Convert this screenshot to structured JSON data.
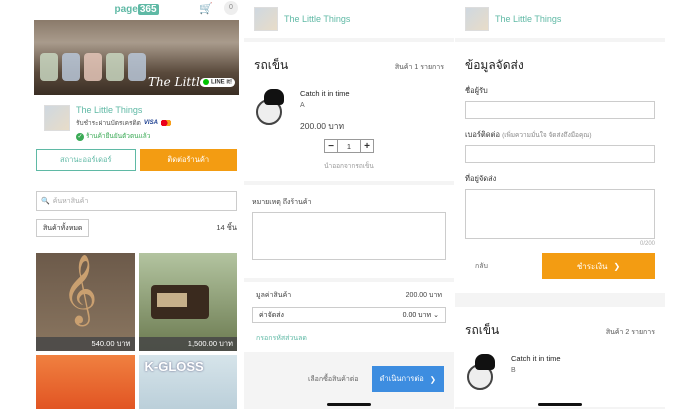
{
  "screen1": {
    "logo_prefix": "page",
    "logo_suffix": "365",
    "cart_count": "0",
    "banner_text": "The Little",
    "line_badge": "LINE it!",
    "shop_name": "The Little Things",
    "payment_text": "รับชำระผ่านบัตรเครดิต",
    "visa": "VISA",
    "verified_text": "ร้านค้ายืนยันตัวตนแล้ว",
    "order_status_button": "สถานะออร์เดอร์",
    "contact_button": "ติดต่อร้านค้า",
    "search_placeholder": "ค้นหาสินค้า",
    "category_select": "สินค้าทั้งหมด",
    "item_count": "14 ชิ้น",
    "products": [
      {
        "price": "540.00 บาท"
      },
      {
        "price": "1,500.00 บาท"
      },
      {
        "price": ""
      },
      {
        "price": ""
      }
    ],
    "kgloss_label": "K-GLOSS"
  },
  "screen2": {
    "shop_name": "The Little Things",
    "cart_title": "รถเข็น",
    "cart_summary": "สินค้า 1 รายการ",
    "item": {
      "name": "Catch it in time",
      "variant": "A",
      "price": "200.00 บาท",
      "qty": "1"
    },
    "remove_label": "นำออกจากรถเข็น",
    "note_label": "หมายเหตุ ถึงร้านค้า",
    "subtotal_label": "มูลค่าสินค้า",
    "subtotal_value": "200.00 บาท",
    "shipping_label": "ค่าจัดส่ง",
    "shipping_value": "0.00 บาท",
    "coupon_label": "กรอกรหัสส่วนลด",
    "continue_label": "เลือกซื้อสินค้าต่อ",
    "proceed_label": "ดำเนินการต่อ"
  },
  "screen3": {
    "shop_name": "The Little Things",
    "section_title": "ข้อมูลจัดส่ง",
    "name_label": "ชื่อผู้รับ",
    "phone_label": "เบอร์ติดต่อ",
    "phone_hint": "(เพิ่มความมั่นใจ จัดส่งถึงมือคุณ)",
    "address_label": "ที่อยู่จัดส่ง",
    "char_count": "0/200",
    "back_label": "กลับ",
    "pay_label": "ชำระเงิน",
    "cart_title": "รถเข็น",
    "cart_summary": "สินค้า 2 รายการ",
    "item": {
      "name": "Catch it in time",
      "variant": "B"
    }
  }
}
